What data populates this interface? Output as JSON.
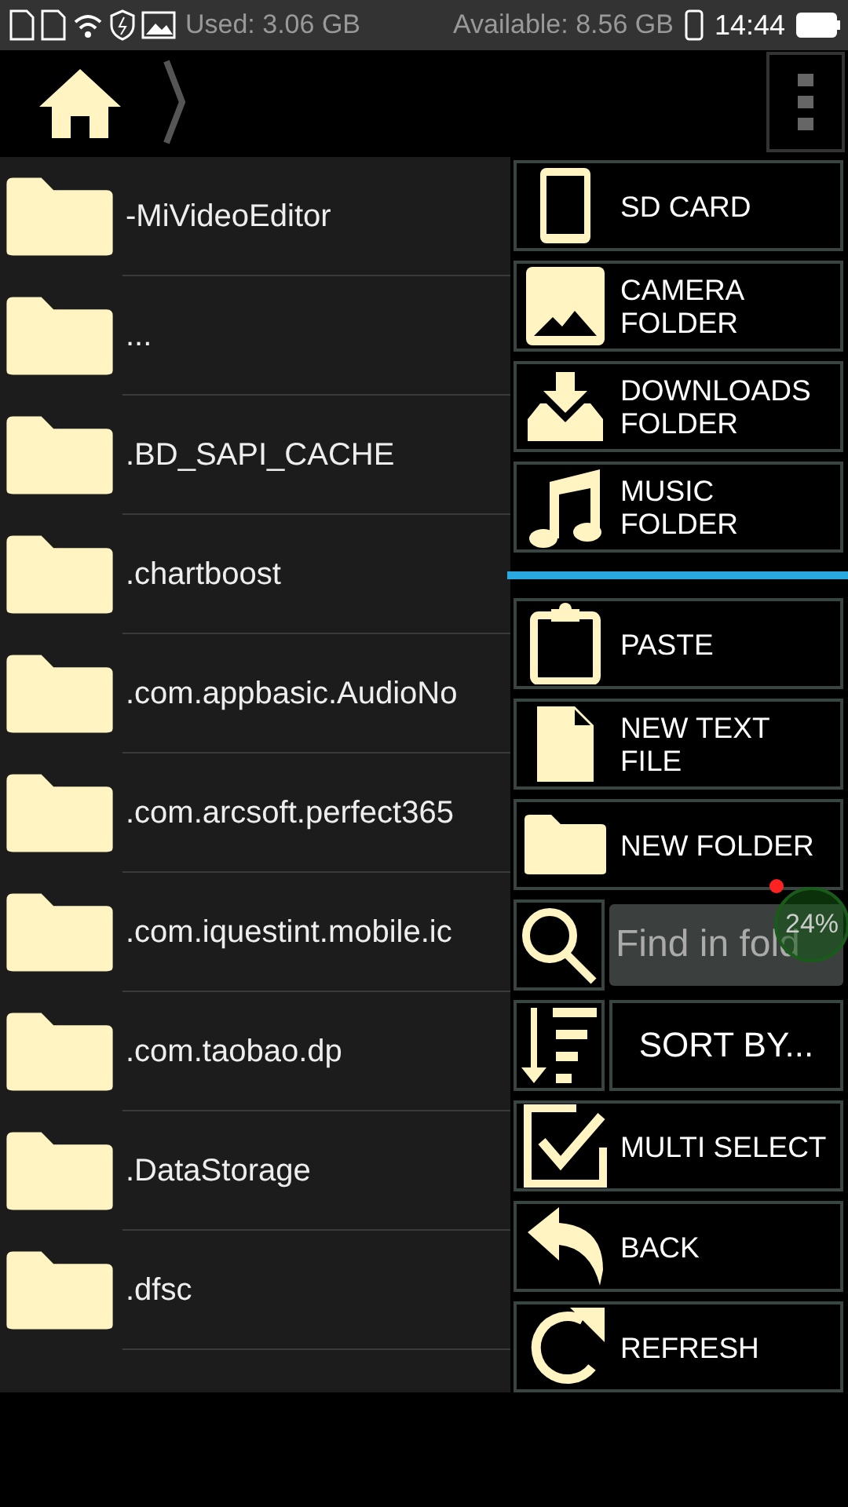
{
  "status_bar": {
    "used": "Used: 3.06 GB",
    "available": "Available: 8.56 GB",
    "time": "14:44"
  },
  "folders": [
    {
      "name": "-MiVideoEditor"
    },
    {
      "name": "..."
    },
    {
      "name": ".BD_SAPI_CACHE"
    },
    {
      "name": ".chartboost"
    },
    {
      "name": ".com.appbasic.AudioNo"
    },
    {
      "name": ".com.arcsoft.perfect365"
    },
    {
      "name": ".com.iquestint.mobile.ic"
    },
    {
      "name": ".com.taobao.dp"
    },
    {
      "name": ".DataStorage"
    },
    {
      "name": ".dfsc"
    }
  ],
  "menu": [
    {
      "kind": "button",
      "label": "SD CARD"
    },
    {
      "kind": "button",
      "label": "CAMERA FOLDER"
    },
    {
      "kind": "button",
      "label": "DOWNLOADS FOLDER"
    },
    {
      "kind": "button",
      "label": "MUSIC FOLDER"
    },
    {
      "kind": "divider"
    },
    {
      "kind": "button",
      "label": "PASTE"
    },
    {
      "kind": "button",
      "label": "NEW TEXT FILE"
    },
    {
      "kind": "button",
      "label": "NEW FOLDER"
    },
    {
      "kind": "search",
      "placeholder": "Find in fold"
    },
    {
      "kind": "split",
      "label": "SORT BY..."
    },
    {
      "kind": "button",
      "label": "MULTI SELECT"
    },
    {
      "kind": "button",
      "label": "BACK"
    },
    {
      "kind": "button",
      "label": "REFRESH"
    }
  ],
  "overlay_badge": "24%"
}
